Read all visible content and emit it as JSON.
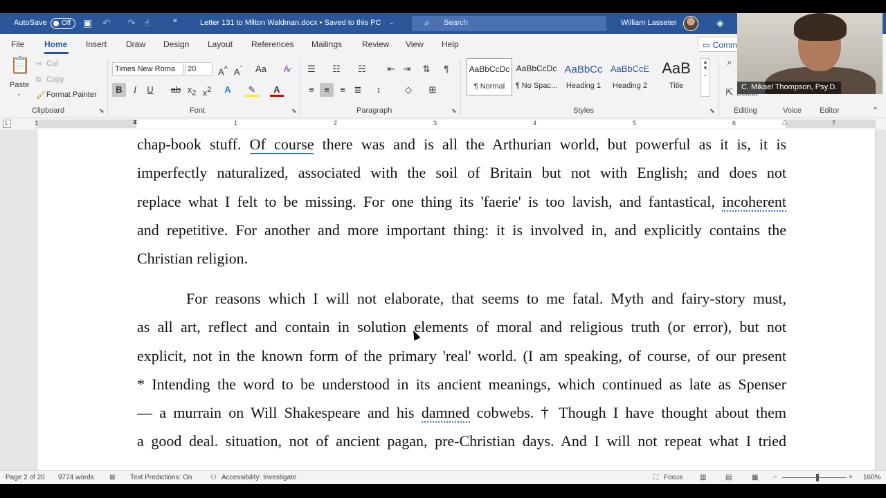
{
  "titlebar": {
    "autosave_label": "AutoSave",
    "autosave_state": "Off",
    "doc_title": "Letter 131 to Milton Waldman.docx • Saved to this PC",
    "search_placeholder": "Search",
    "user_name": "William Lasseter"
  },
  "tabs": [
    "File",
    "Home",
    "Insert",
    "Draw",
    "Design",
    "Layout",
    "References",
    "Mailings",
    "Review",
    "View",
    "Help"
  ],
  "active_tab": "Home",
  "comments_label": "Comm",
  "ribbon": {
    "clipboard": {
      "paste": "Paste",
      "cut": "Cut",
      "copy": "Copy",
      "format_painter": "Format Painter",
      "label": "Clipboard"
    },
    "font": {
      "family": "Times New Roma",
      "size": "20",
      "label": "Font"
    },
    "paragraph": {
      "label": "Paragraph"
    },
    "styles": {
      "label": "Styles",
      "items": [
        {
          "sample": "AaBbCcDc",
          "name": "¶ Normal"
        },
        {
          "sample": "AaBbCcDc",
          "name": "¶ No Spac..."
        },
        {
          "sample": "AaBbCc",
          "name": "Heading 1"
        },
        {
          "sample": "AaBbCcE",
          "name": "Heading 2"
        },
        {
          "sample": "AaB",
          "name": "Title"
        }
      ]
    },
    "editing": {
      "select": "Select",
      "label": "Editing"
    },
    "voice": {
      "label": "Voice"
    },
    "editor": {
      "label": "Editor"
    }
  },
  "ruler": {
    "numbers": [
      "1",
      "1",
      "2",
      "3",
      "4",
      "5",
      "6",
      "7"
    ]
  },
  "document": {
    "l1": {
      "a": "chap-book stuff. ",
      "b": "Of course",
      "c": " there was and is all the Arthurian world, but powerful as it is, it is"
    },
    "l2": "imperfectly naturalized, associated with the soil of Britain but not with English; and does not",
    "l3": {
      "a": "replace what I felt to be missing. For one thing its 'faerie' is too lavish, and fantastical, ",
      "b": "incoherent"
    },
    "l4": "and repetitive. For another and more important thing: it is involved in, and explicitly contains the",
    "l5": "Christian religion.",
    "l6": "For reasons which I will not elaborate, that seems to me fatal. Myth and fairy-story must,",
    "l7": "as all art, reflect and contain in solution elements of moral and religious truth (or error), but not",
    "l8": "explicit, not in the known form of the primary 'real' world. (I am speaking, of course, of our present",
    "l9": "* Intending the word to be understood in its ancient meanings, which continued as late as Spenser",
    "l10": {
      "a": "— a murrain on Will Shakespeare and his ",
      "b": "damned",
      "c": " cobwebs. † Though I have thought about them"
    },
    "l11": "a good deal. situation, not of ancient pagan, pre-Christian days. And I will not repeat what I tried"
  },
  "statusbar": {
    "page": "Page 2 of 20",
    "words": "9774 words",
    "text_predictions": "Text Predictions: On",
    "accessibility": "Accessibility: Investigate",
    "focus": "Focus",
    "zoom": "160%"
  },
  "video": {
    "participant_name": "C. Mikael Thompson, Psy.D."
  },
  "colors": {
    "titlebar": "#2b579a",
    "ribbon": "#f3f3f3",
    "accent": "#2b579a",
    "canvas": "#e6e6e6"
  }
}
